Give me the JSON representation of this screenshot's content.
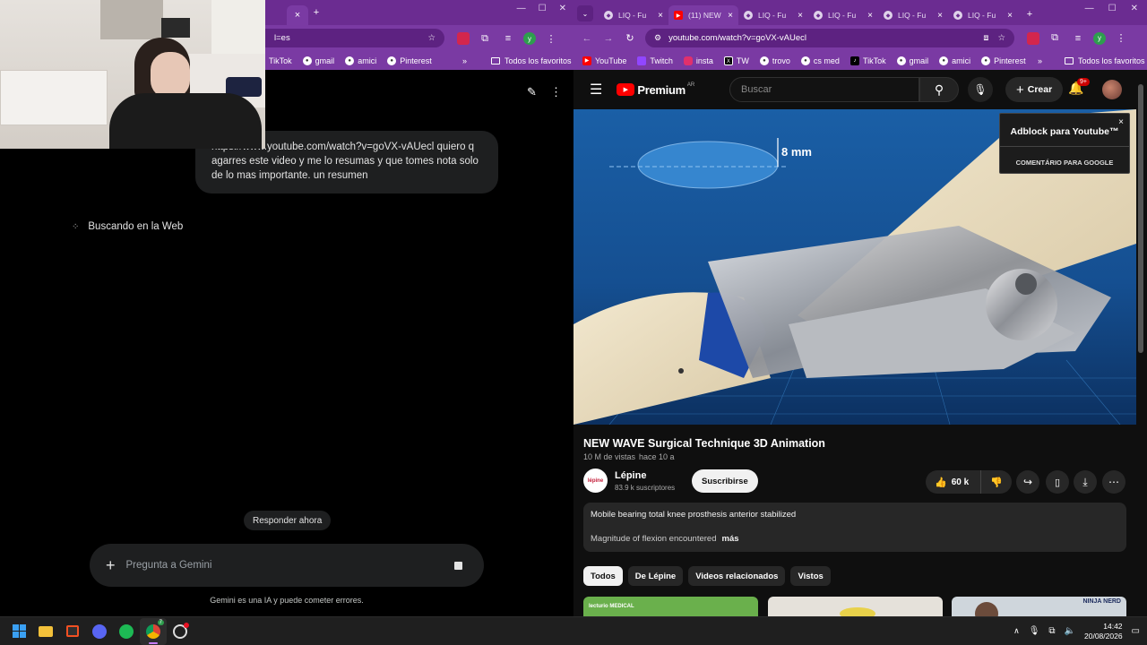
{
  "left": {
    "tabbar": {
      "close": "×",
      "new_tab": "+"
    },
    "omnibox": {
      "url_tail": "l=es"
    },
    "bookmarks": [
      "TikTok",
      "gmail",
      "amici",
      "Pinterest"
    ],
    "bookmarks_more": "»",
    "all_bookmarks": "Todos los favoritos",
    "gemini": {
      "user_message": "https://www.youtube.com/watch?v=goVX-vAUecl quiero q agarres este video y me lo resumas y que tomes nota solo de lo mas importante. un resumen",
      "searching": "Buscando en la Web",
      "respond_now": "Responder ahora",
      "input_placeholder": "Pregunta a Gemini",
      "disclaimer": "Gemini es una IA y puede cometer errores."
    }
  },
  "right": {
    "tabs": [
      {
        "label": "LIQ - Fu",
        "active": false
      },
      {
        "label": "(11) NEW",
        "active": true
      },
      {
        "label": "LIQ - Fu",
        "active": false
      },
      {
        "label": "LIQ - Fu",
        "active": false
      },
      {
        "label": "LIQ - Fu",
        "active": false
      },
      {
        "label": "LIQ - Fu",
        "active": false
      }
    ],
    "tab_close": "×",
    "new_tab": "+",
    "url": "youtube.com/watch?v=goVX-vAUecl",
    "bookmarks": [
      "YouTube",
      "Twitch",
      "insta",
      "TW",
      "trovo",
      "cs med",
      "TikTok",
      "gmail",
      "amici",
      "Pinterest"
    ],
    "bookmarks_more": "»",
    "all_bookmarks": "Todos los favoritos",
    "youtube": {
      "logo": "Premium",
      "region": "AR",
      "search_placeholder": "Buscar",
      "create": "Crear",
      "notifications": "9+",
      "video_measure": "8 mm",
      "adblock_title": "Adblock para Youtube™",
      "adblock_sub": "COMENTÁRIO PARA GOOGLE",
      "adblock_close": "×",
      "video_title": "NEW WAVE Surgical Technique 3D Animation",
      "views": "10 M de vistas",
      "ago": "hace 10 a",
      "channel_name": "Lépine",
      "channel_subs": "83.9 k suscriptores",
      "channel_avatar": "lépine",
      "subscribe": "Suscribirse",
      "likes": "60 k",
      "desc_line1": "Mobile bearing total knee prosthesis anterior stabilized",
      "desc_line2": "Magnitude of flexion encountered",
      "more": "más",
      "chips": [
        "Todos",
        "De Lépine",
        "Videos relacionados",
        "Vistos"
      ],
      "thumb1_label": "lecturio MEDICAL",
      "thumb3_label": "NINJA NERD"
    }
  },
  "webcam": {
    "description": ""
  },
  "taskbar": {
    "time": "14:42",
    "date": "20/08/2026",
    "chrome_badge": "7",
    "tray_chevron": "∧"
  },
  "colors": {
    "browser_frame": "#6b2c91",
    "toolbar": "#7a3aa3",
    "youtube_red": "#ff0000",
    "youtube_bg": "#0f0f0f"
  }
}
